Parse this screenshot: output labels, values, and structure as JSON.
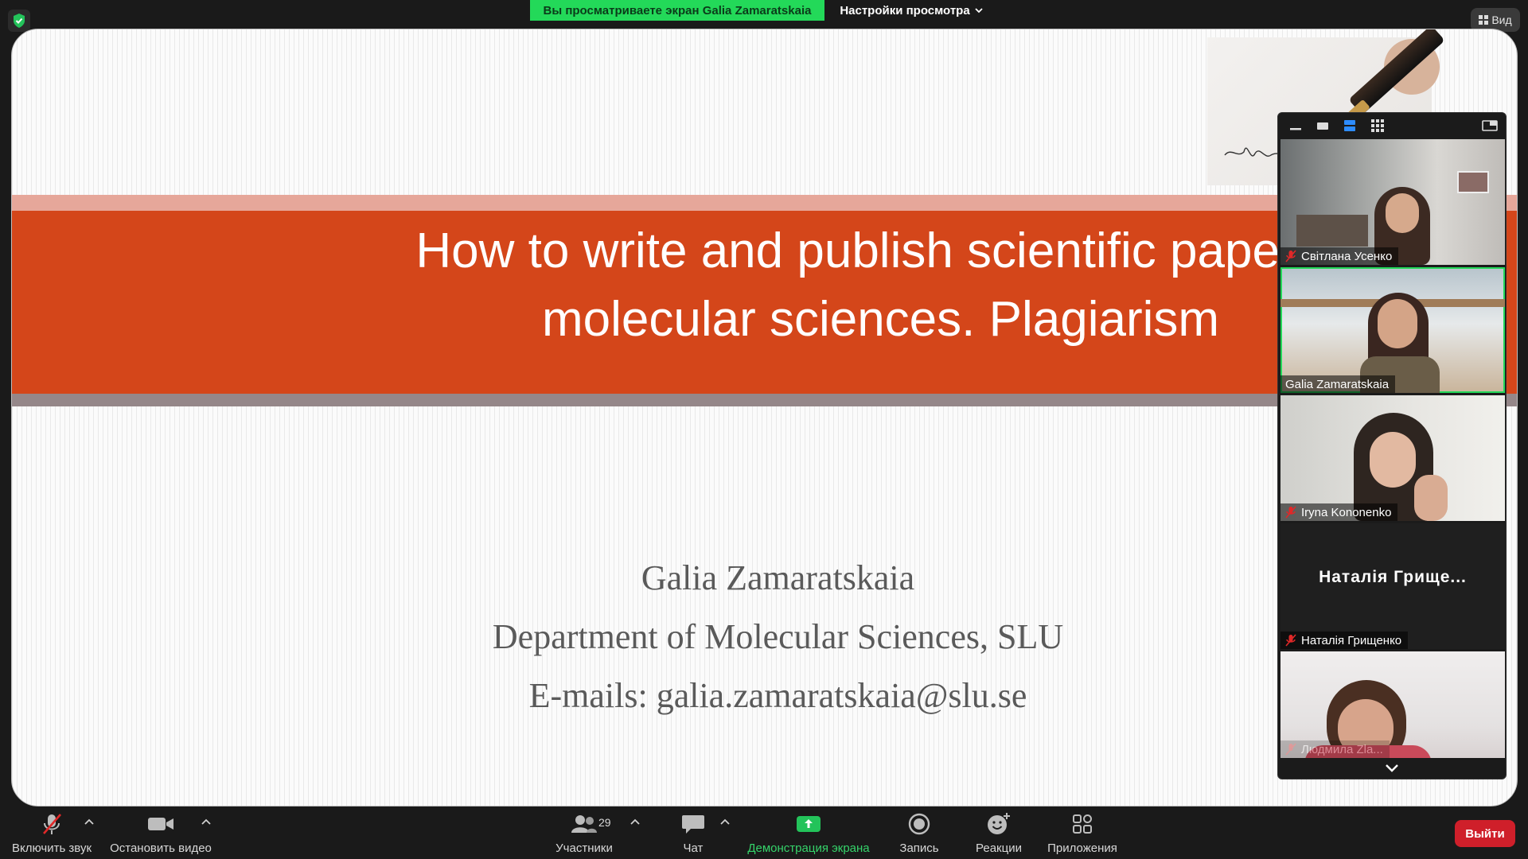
{
  "top_bar": {
    "viewing_banner": "Вы просматриваете экран Galia Zamaratskaia",
    "view_settings": "Настройки просмотра",
    "view_button": "Вид"
  },
  "slide": {
    "title_line1": "How to write and publish scientific paper w",
    "title_line2": "molecular sciences. Plagiarism",
    "author": "Galia Zamaratskaia",
    "department": "Department of Molecular Sciences, SLU",
    "email": "E-mails: galia.zamaratskaia@slu.se",
    "colors": {
      "band_main": "#d4461a",
      "band_top": "#e6a79a",
      "band_bottom": "#958789"
    }
  },
  "gallery": {
    "toolbar_icons": [
      "minimize-icon",
      "speaker-view-icon",
      "strip-view-icon",
      "grid-view-icon",
      "popout-icon"
    ],
    "participants": [
      {
        "name": "Світлана Усенко",
        "muted": true
      },
      {
        "name": "Galia Zamaratskaia",
        "muted": false
      },
      {
        "name": "Iryna Kononenko",
        "muted": true
      },
      {
        "name": "Наталія Грищенко",
        "muted": true,
        "avatar_text": "Наталія Грище..."
      },
      {
        "name": "Людмила Zla...",
        "muted": true
      }
    ]
  },
  "bottom_bar": {
    "unmute": "Включить звук",
    "stop_video": "Остановить видео",
    "participants": "Участники",
    "participants_count": "29",
    "chat": "Чат",
    "share_screen": "Демонстрация экрана",
    "record": "Запись",
    "reactions": "Реакции",
    "apps": "Приложения",
    "leave": "Выйти"
  }
}
